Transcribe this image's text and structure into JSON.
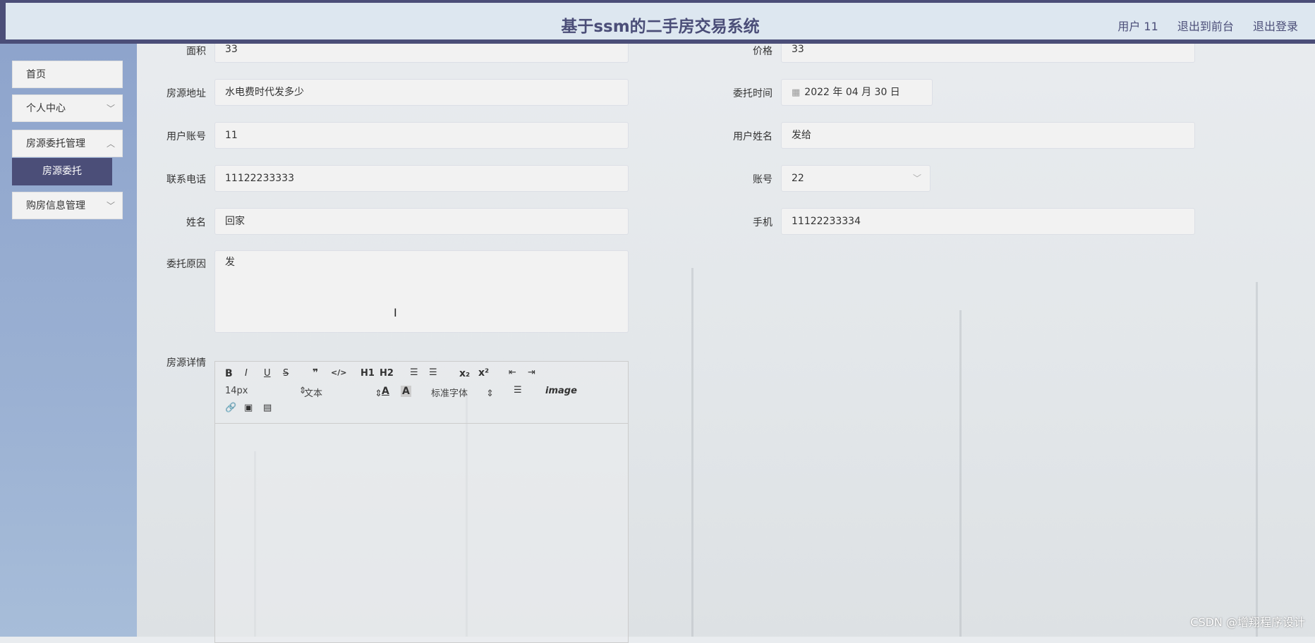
{
  "header": {
    "title": "基于ssm的二手房交易系统",
    "user": "用户 11",
    "to_front": "退出到前台",
    "logout": "退出登录"
  },
  "sidebar": {
    "items": [
      {
        "label": "首页"
      },
      {
        "label": "个人中心"
      },
      {
        "label": "房源委托管理"
      },
      {
        "label": "购房信息管理"
      }
    ],
    "sub_active": "房源委托"
  },
  "form": {
    "area": {
      "label": "面积",
      "value": "33"
    },
    "price": {
      "label": "价格",
      "value": "33"
    },
    "address": {
      "label": "房源地址",
      "value": "水电费时代发多少"
    },
    "entrust_time": {
      "label": "委托时间",
      "value": "2022 年 04 月 30 日"
    },
    "user_account": {
      "label": "用户账号",
      "value": "11"
    },
    "user_name": {
      "label": "用户姓名",
      "value": "发给"
    },
    "phone": {
      "label": "联系电话",
      "value": "11122233333"
    },
    "account": {
      "label": "账号",
      "value": "22"
    },
    "name": {
      "label": "姓名",
      "value": "回家"
    },
    "mobile": {
      "label": "手机",
      "value": "11122233334"
    },
    "reason": {
      "label": "委托原因",
      "value": "发"
    },
    "details": {
      "label": "房源详情"
    }
  },
  "editor": {
    "font_size": "14px",
    "text_type": "文本",
    "font_family": "标准字体",
    "buttons": [
      "B",
      "I",
      "U",
      "S",
      "❞",
      "</>",
      "H1",
      "H2",
      "ol",
      "ul",
      "x₂",
      "x²",
      "outdent",
      "indent",
      "A",
      "A",
      "align",
      "Tx",
      "link",
      "image",
      "video"
    ]
  },
  "watermark": "CSDN @增翔程序设计"
}
